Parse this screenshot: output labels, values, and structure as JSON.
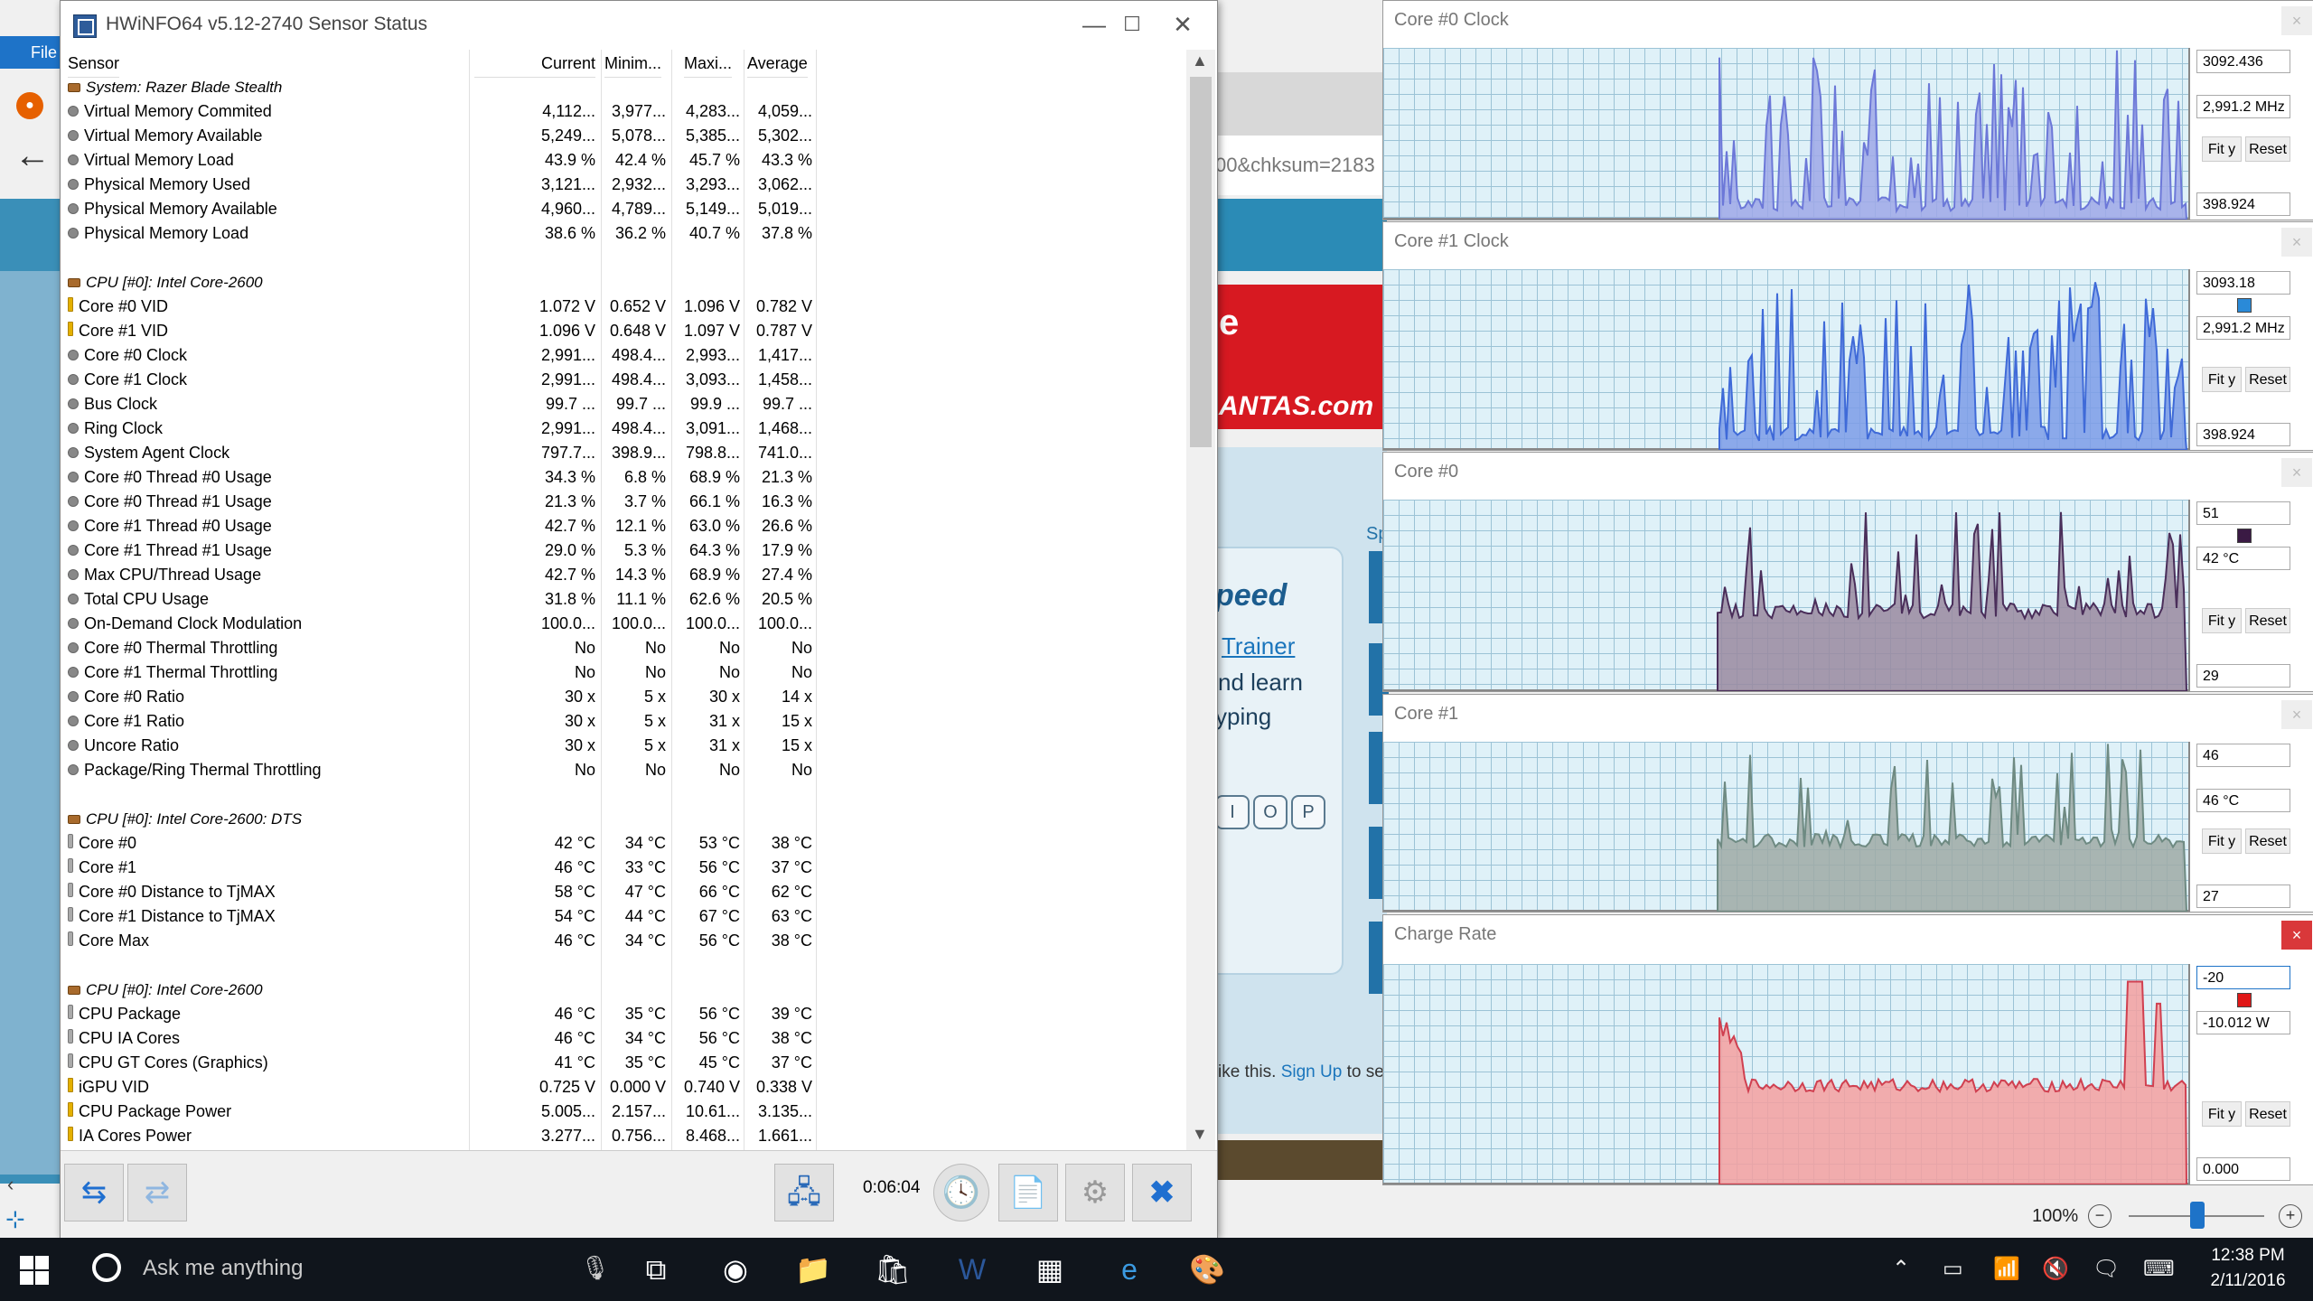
{
  "browser": {
    "file_label": "File",
    "url_fragment": "00&chksum=2183",
    "ad_letter": "e",
    "ad_brand": "ANTAS.com",
    "headline": "peed",
    "link_trainer": "Trainer",
    "text_learn": "nd learn",
    "text_typing": "yping",
    "keys": [
      "I",
      "O",
      "P"
    ],
    "side_label": "Sp",
    "signup_prefix": "ike this. ",
    "signup_link": "Sign Up",
    "signup_suffix": " to se",
    "zoom": "100%"
  },
  "hwinfo": {
    "title": "HWiNFO64 v5.12-2740 Sensor Status",
    "columns": [
      "Sensor",
      "Current",
      "Minim...",
      "Maxi...",
      "Average"
    ],
    "rows": [
      {
        "type": "group",
        "name": "System: Razer Blade Stealth"
      },
      {
        "type": "dot",
        "name": "Virtual Memory Commited",
        "cur": "4,112...",
        "min": "3,977...",
        "max": "4,283...",
        "avg": "4,059..."
      },
      {
        "type": "dot",
        "name": "Virtual Memory Available",
        "cur": "5,249...",
        "min": "5,078...",
        "max": "5,385...",
        "avg": "5,302..."
      },
      {
        "type": "dot",
        "name": "Virtual Memory Load",
        "cur": "43.9 %",
        "min": "42.4 %",
        "max": "45.7 %",
        "avg": "43.3 %"
      },
      {
        "type": "dot",
        "name": "Physical Memory Used",
        "cur": "3,121...",
        "min": "2,932...",
        "max": "3,293...",
        "avg": "3,062..."
      },
      {
        "type": "dot",
        "name": "Physical Memory Available",
        "cur": "4,960...",
        "min": "4,789...",
        "max": "5,149...",
        "avg": "5,019..."
      },
      {
        "type": "dot",
        "name": "Physical Memory Load",
        "cur": "38.6 %",
        "min": "36.2 %",
        "max": "40.7 %",
        "avg": "37.8 %"
      },
      {
        "type": "blank"
      },
      {
        "type": "group",
        "name": "CPU [#0]: Intel Core-2600"
      },
      {
        "type": "volt",
        "name": "Core #0 VID",
        "cur": "1.072 V",
        "min": "0.652 V",
        "max": "1.096 V",
        "avg": "0.782 V"
      },
      {
        "type": "volt",
        "name": "Core #1 VID",
        "cur": "1.096 V",
        "min": "0.648 V",
        "max": "1.097 V",
        "avg": "0.787 V"
      },
      {
        "type": "dot",
        "name": "Core #0 Clock",
        "cur": "2,991...",
        "min": "498.4...",
        "max": "2,993...",
        "avg": "1,417..."
      },
      {
        "type": "dot",
        "name": "Core #1 Clock",
        "cur": "2,991...",
        "min": "498.4...",
        "max": "3,093...",
        "avg": "1,458..."
      },
      {
        "type": "dot",
        "name": "Bus Clock",
        "cur": "99.7 ...",
        "min": "99.7 ...",
        "max": "99.9 ...",
        "avg": "99.7 ..."
      },
      {
        "type": "dot",
        "name": "Ring Clock",
        "cur": "2,991...",
        "min": "498.4...",
        "max": "3,091...",
        "avg": "1,468..."
      },
      {
        "type": "dot",
        "name": "System Agent Clock",
        "cur": "797.7...",
        "min": "398.9...",
        "max": "798.8...",
        "avg": "741.0..."
      },
      {
        "type": "dot",
        "name": "Core #0 Thread #0 Usage",
        "cur": "34.3 %",
        "min": "6.8 %",
        "max": "68.9 %",
        "avg": "21.3 %"
      },
      {
        "type": "dot",
        "name": "Core #0 Thread #1 Usage",
        "cur": "21.3 %",
        "min": "3.7 %",
        "max": "66.1 %",
        "avg": "16.3 %"
      },
      {
        "type": "dot",
        "name": "Core #1 Thread #0 Usage",
        "cur": "42.7 %",
        "min": "12.1 %",
        "max": "63.0 %",
        "avg": "26.6 %"
      },
      {
        "type": "dot",
        "name": "Core #1 Thread #1 Usage",
        "cur": "29.0 %",
        "min": "5.3 %",
        "max": "64.3 %",
        "avg": "17.9 %"
      },
      {
        "type": "dot",
        "name": "Max CPU/Thread Usage",
        "cur": "42.7 %",
        "min": "14.3 %",
        "max": "68.9 %",
        "avg": "27.4 %"
      },
      {
        "type": "dot",
        "name": "Total CPU Usage",
        "cur": "31.8 %",
        "min": "11.1 %",
        "max": "62.6 %",
        "avg": "20.5 %"
      },
      {
        "type": "dot",
        "name": "On-Demand Clock Modulation",
        "cur": "100.0...",
        "min": "100.0...",
        "max": "100.0...",
        "avg": "100.0..."
      },
      {
        "type": "dot",
        "name": "Core #0 Thermal Throttling",
        "cur": "No",
        "min": "No",
        "max": "No",
        "avg": "No"
      },
      {
        "type": "dot",
        "name": "Core #1 Thermal Throttling",
        "cur": "No",
        "min": "No",
        "max": "No",
        "avg": "No"
      },
      {
        "type": "dot",
        "name": "Core #0 Ratio",
        "cur": "30 x",
        "min": "5 x",
        "max": "30 x",
        "avg": "14 x"
      },
      {
        "type": "dot",
        "name": "Core #1 Ratio",
        "cur": "30 x",
        "min": "5 x",
        "max": "31 x",
        "avg": "15 x"
      },
      {
        "type": "dot",
        "name": "Uncore Ratio",
        "cur": "30 x",
        "min": "5 x",
        "max": "31 x",
        "avg": "15 x"
      },
      {
        "type": "dot",
        "name": "Package/Ring Thermal Throttling",
        "cur": "No",
        "min": "No",
        "max": "No",
        "avg": "No"
      },
      {
        "type": "blank"
      },
      {
        "type": "group",
        "name": "CPU [#0]: Intel Core-2600: DTS"
      },
      {
        "type": "temp",
        "name": "Core #0",
        "cur": "42 °C",
        "min": "34 °C",
        "max": "53 °C",
        "avg": "38 °C"
      },
      {
        "type": "temp",
        "name": "Core #1",
        "cur": "46 °C",
        "min": "33 °C",
        "max": "56 °C",
        "avg": "37 °C"
      },
      {
        "type": "temp",
        "name": "Core #0 Distance to TjMAX",
        "cur": "58 °C",
        "min": "47 °C",
        "max": "66 °C",
        "avg": "62 °C"
      },
      {
        "type": "temp",
        "name": "Core #1 Distance to TjMAX",
        "cur": "54 °C",
        "min": "44 °C",
        "max": "67 °C",
        "avg": "63 °C"
      },
      {
        "type": "temp",
        "name": "Core Max",
        "cur": "46 °C",
        "min": "34 °C",
        "max": "56 °C",
        "avg": "38 °C"
      },
      {
        "type": "blank"
      },
      {
        "type": "group",
        "name": "CPU [#0]: Intel Core-2600"
      },
      {
        "type": "temp",
        "name": "CPU Package",
        "cur": "46 °C",
        "min": "35 °C",
        "max": "56 °C",
        "avg": "39 °C"
      },
      {
        "type": "temp",
        "name": "CPU IA Cores",
        "cur": "46 °C",
        "min": "34 °C",
        "max": "56 °C",
        "avg": "38 °C"
      },
      {
        "type": "temp",
        "name": "CPU GT Cores (Graphics)",
        "cur": "41 °C",
        "min": "35 °C",
        "max": "45 °C",
        "avg": "37 °C"
      },
      {
        "type": "volt",
        "name": "iGPU VID",
        "cur": "0.725 V",
        "min": "0.000 V",
        "max": "0.740 V",
        "avg": "0.338 V"
      },
      {
        "type": "volt",
        "name": "CPU Package Power",
        "cur": "5.005...",
        "min": "2.157...",
        "max": "10.61...",
        "avg": "3.135..."
      },
      {
        "type": "volt",
        "name": "IA Cores Power",
        "cur": "3.277...",
        "min": "0.756...",
        "max": "8.468...",
        "avg": "1.661..."
      }
    ],
    "timer": "0:06:04"
  },
  "graphs": [
    {
      "title": "Core #0 Clock",
      "top_value": "3092.436",
      "current_value": "2,991.2 MHz",
      "fit_label": "Fit y",
      "reset_label": "Reset",
      "bottom_value": "398.924",
      "color": "#9fa8e8",
      "line": "#6c78d8",
      "swatch": null,
      "closable_active": false
    },
    {
      "title": "Core #1 Clock",
      "top_value": "3093.18",
      "current_value": "2,991.2 MHz",
      "fit_label": "Fit y",
      "reset_label": "Reset",
      "bottom_value": "398.924",
      "color": "#7d9ce8",
      "line": "#3f6ad8",
      "swatch": "#2a8ad8",
      "closable_active": false
    },
    {
      "title": "Core #0",
      "top_value": "51",
      "current_value": "42 °C",
      "fit_label": "Fit y",
      "reset_label": "Reset",
      "bottom_value": "29",
      "color": "#9a8aa0",
      "line": "#4a2e5a",
      "swatch": "#3a1a44",
      "closable_active": false
    },
    {
      "title": "Core #1",
      "top_value": "46",
      "current_value": "46 °C",
      "fit_label": "Fit y",
      "reset_label": "Reset",
      "bottom_value": "27",
      "color": "#9faaa6",
      "line": "#6e8a82",
      "swatch": null,
      "closable_active": false
    },
    {
      "title": "Charge Rate",
      "top_value": "-20",
      "current_value": "-10.012 W",
      "fit_label": "Fit y",
      "reset_label": "Reset",
      "bottom_value": "0.000",
      "color": "#f4a0a0",
      "line": "#d04050",
      "swatch": "#e01818",
      "closable_active": true
    }
  ],
  "taskbar": {
    "search_placeholder": "Ask me anything",
    "time": "12:38 PM",
    "date": "2/11/2016"
  }
}
